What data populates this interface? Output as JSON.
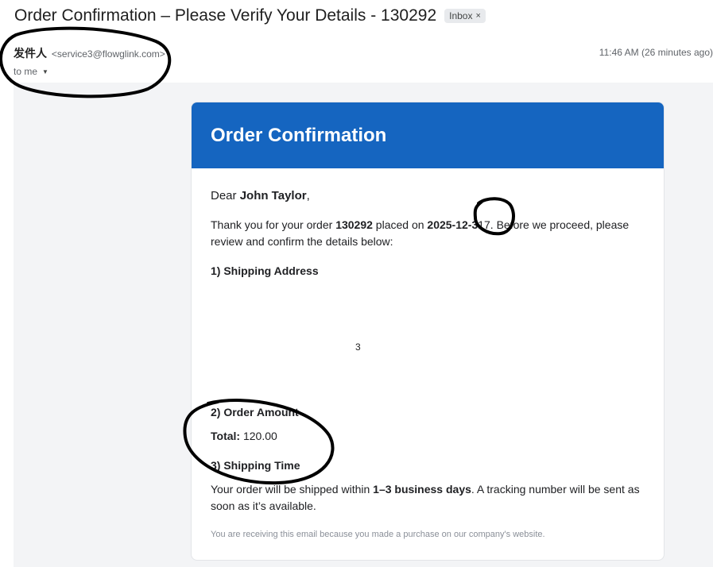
{
  "email": {
    "subject": "Order Confirmation – Please Verify Your Details - 130292",
    "label_badge": "Inbox",
    "label_remove": "×",
    "sender_name": "发件人",
    "sender_email": "<service3@flowglink.com>",
    "to_text": "to me",
    "timestamp": "11:46 AM (26 minutes ago)"
  },
  "card": {
    "header_title": "Order Confirmation",
    "greeting_prefix": "Dear ",
    "customer_name": "John Taylor",
    "greeting_suffix": ",",
    "intro_part1": "Thank you for your order ",
    "order_number": "130292",
    "intro_part2": " placed on ",
    "order_date": "2025-12-3",
    "intro_part3": "17. Before we proceed, please review and confirm the details below:",
    "section1_heading": "1) Shipping Address",
    "stray_char": "3",
    "section2_heading": "2) Order Amount",
    "total_label": "Total:",
    "total_value": " 120.00",
    "section3_heading": "3) Shipping Time",
    "ship_part1": "Your order will be shipped within ",
    "ship_days": "1–3 business days",
    "ship_part2": ". A tracking number will be sent as soon as it’s available.",
    "footer_note": "You are receiving this email because you made a purchase on our company's website."
  },
  "colors": {
    "header_blue": "#1565c0",
    "email_background": "#f3f4f6",
    "annotation_ink": "#000000"
  }
}
